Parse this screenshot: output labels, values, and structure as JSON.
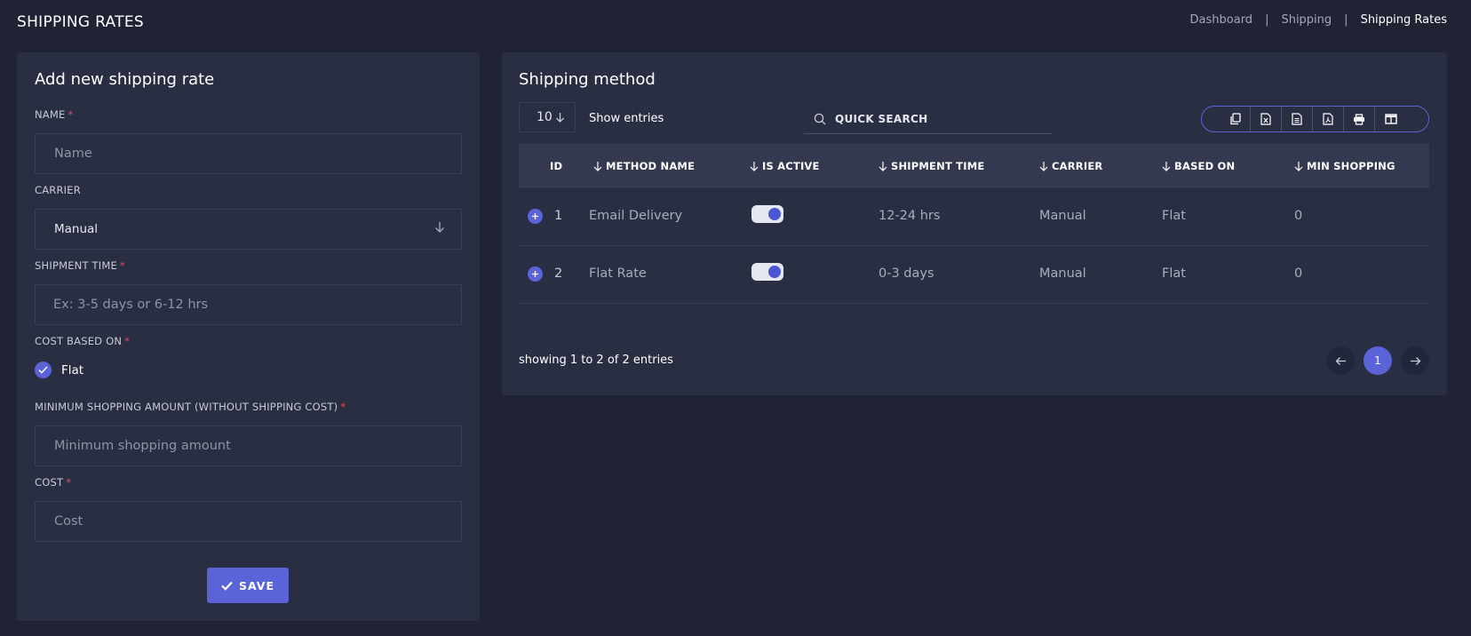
{
  "header": {
    "title": "SHIPPING RATES",
    "breadcrumb": [
      "Dashboard",
      "Shipping",
      "Shipping Rates"
    ],
    "separator": "|"
  },
  "form": {
    "title": "Add new shipping rate",
    "name_label": "NAME",
    "name_placeholder": "Name",
    "carrier_label": "CARRIER",
    "carrier_value": "Manual",
    "shipment_time_label": "SHIPMENT TIME",
    "shipment_time_placeholder": "Ex: 3-5 days or 6-12 hrs",
    "cost_based_on_label": "COST BASED ON",
    "cost_based_on_option": "Flat",
    "cost_based_on_checked": true,
    "min_shopping_label": "MINIMUM SHOPPING AMOUNT (WITHOUT SHIPPING COST)",
    "min_shopping_placeholder": "Minimum shopping amount",
    "cost_label": "COST",
    "cost_placeholder": "Cost",
    "required_mark": "*",
    "save_label": "SAVE"
  },
  "table": {
    "title": "Shipping method",
    "page_size": "10",
    "show_entries_label": "Show entries",
    "search_placeholder": "QUICK SEARCH",
    "export_icons": [
      "copy-icon",
      "excel-icon",
      "csv-icon",
      "pdf-icon",
      "print-icon",
      "columns-icon"
    ],
    "columns": [
      "ID",
      "METHOD NAME",
      "IS ACTIVE",
      "SHIPMENT TIME",
      "CARRIER",
      "BASED ON",
      "MIN SHOPPING"
    ],
    "rows": [
      {
        "id": "1",
        "method_name": "Email Delivery",
        "is_active": true,
        "shipment_time": "12-24 hrs",
        "carrier": "Manual",
        "based_on": "Flat",
        "min_shopping": "0"
      },
      {
        "id": "2",
        "method_name": "Flat Rate",
        "is_active": true,
        "shipment_time": "0-3 days",
        "carrier": "Manual",
        "based_on": "Flat",
        "min_shopping": "0"
      }
    ],
    "showing_text": "showing 1 to 2 of 2 entries",
    "current_page": "1"
  },
  "colors": {
    "background": "#1f2333",
    "card": "#2a2e42",
    "accent": "#5a63d8",
    "required": "#e04a5f"
  }
}
